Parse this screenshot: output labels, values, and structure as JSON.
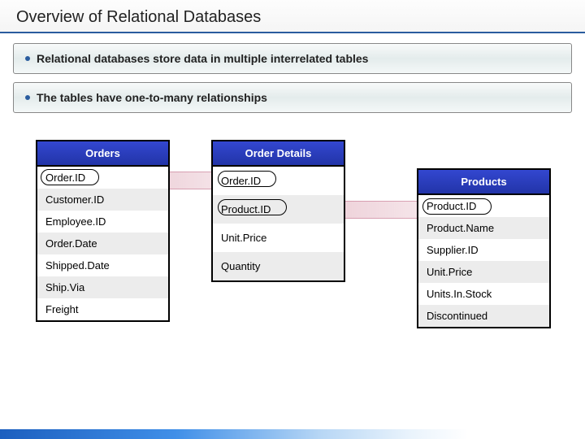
{
  "title": "Overview of Relational Databases",
  "bullets": [
    "Relational databases store data in multiple interrelated tables",
    "The tables have one-to-many relationships"
  ],
  "tables": {
    "orders": {
      "name": "Orders",
      "fields": [
        "Order.ID",
        "Customer.ID",
        "Employee.ID",
        "Order.Date",
        "Shipped.Date",
        "Ship.Via",
        "Freight"
      ]
    },
    "order_details": {
      "name": "Order Details",
      "fields": [
        "Order.ID",
        "Product.ID",
        "Unit.Price",
        "Quantity"
      ]
    },
    "products": {
      "name": "Products",
      "fields": [
        "Product.ID",
        "Product.Name",
        "Supplier.ID",
        "Unit.Price",
        "Units.In.Stock",
        "Discontinued"
      ]
    }
  }
}
